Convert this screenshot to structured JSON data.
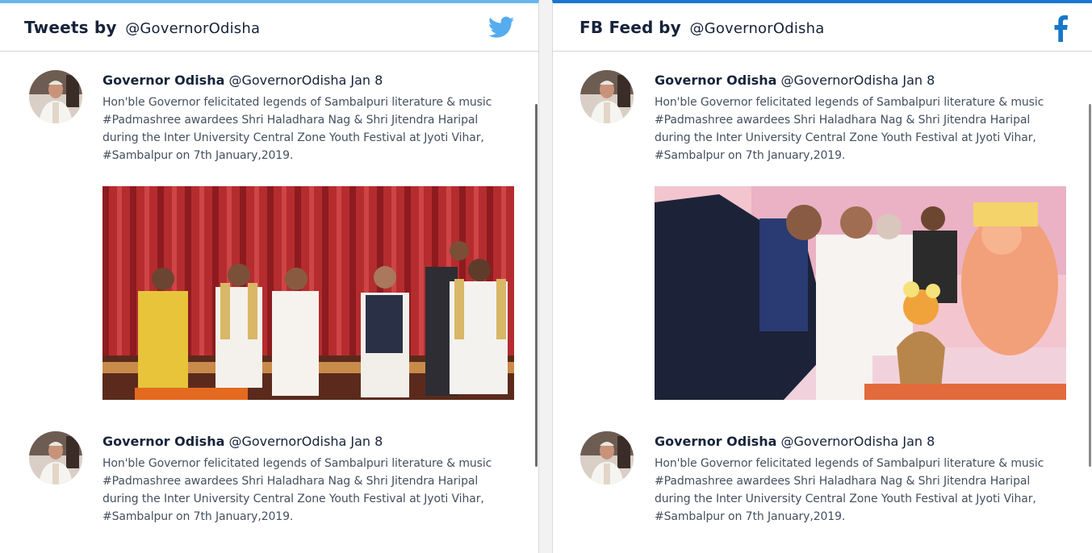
{
  "twitter_panel": {
    "title_bold": "Tweets by",
    "title_handle": "@GovernorOdisha",
    "brand_icon": "twitter-bird-icon",
    "accent_color": "#69b6ec",
    "posts": [
      {
        "author": "Governor Odisha",
        "handle": "@GovernorOdisha",
        "date": "Jan 8",
        "text": "Hon'ble Governor felicitated legends of Sambalpuri literature & music\n#Padmashree awardees Shri Haladhara Nag & Shri  Jitendra Haripal\nduring the  Inter University Central Zone Youth Festival at Jyoti Vihar,\n#Sambalpur on 7th January,2019.",
        "has_image": true
      },
      {
        "author": "Governor Odisha",
        "handle": "@GovernorOdisha",
        "date": "Jan 8",
        "text": "Hon'ble Governor felicitated legends of Sambalpuri literature & music\n#Padmashree awardees Shri Haladhara Nag & Shri  Jitendra Haripal\nduring the  Inter University Central Zone Youth Festival at Jyoti Vihar,\n#Sambalpur on 7th January,2019.",
        "has_image": false
      }
    ]
  },
  "fb_panel": {
    "title_bold": "FB Feed",
    "title_by": "by",
    "title_handle": "@GovernorOdisha",
    "brand_icon": "facebook-f-icon",
    "accent_color": "#1976d2",
    "posts": [
      {
        "author": "Governor Odisha",
        "handle": "@GovernorOdisha",
        "date": "Jan 8",
        "text": "Hon'ble Governor felicitated legends of Sambalpuri literature & music\n#Padmashree awardees Shri Haladhara Nag & Shri  Jitendra Haripal\nduring the  Inter University Central Zone Youth Festival at Jyoti Vihar,\n#Sambalpur on 7th January,2019.",
        "has_image": true
      },
      {
        "author": "Governor Odisha",
        "handle": "@GovernorOdisha",
        "date": "Jan 8",
        "text": "Hon'ble Governor felicitated legends of Sambalpuri literature & music\n#Padmashree awardees Shri Haladhara Nag & Shri  Jitendra Haripal\nduring the  Inter University Central Zone Youth Festival at Jyoti Vihar,\n#Sambalpur on 7th January,2019.",
        "has_image": false
      }
    ]
  }
}
